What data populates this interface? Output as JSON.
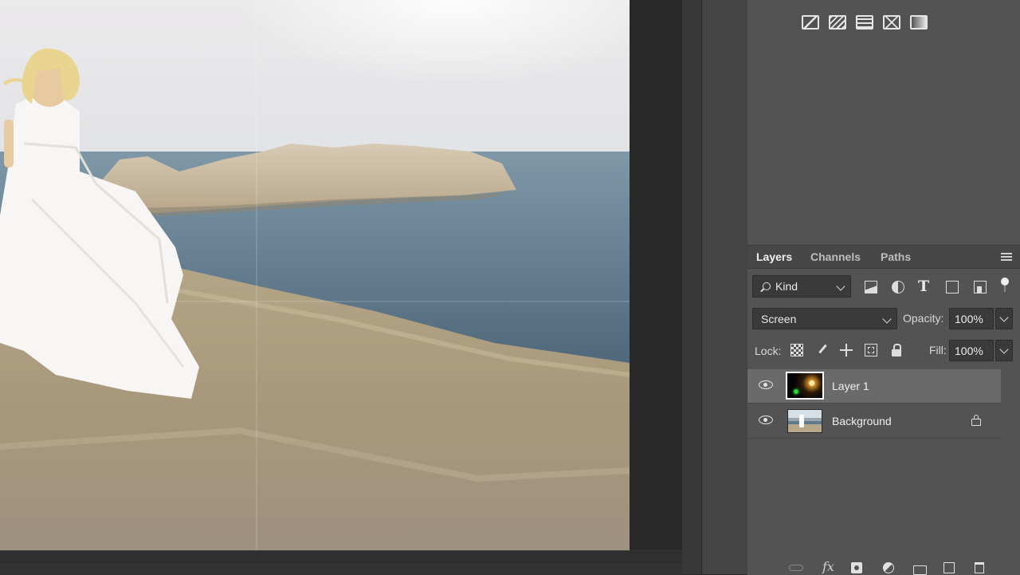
{
  "colors": {
    "panel_bg": "#535353",
    "selected_row": "#6a6a6a",
    "canvas_bg": "#282828"
  },
  "adjustments": {
    "icons": [
      "invert-icon",
      "posterize-icon",
      "threshold-icon",
      "selective-color-icon",
      "gradient-map-icon"
    ]
  },
  "layers_panel": {
    "tabs": [
      {
        "label": "Layers",
        "active": true
      },
      {
        "label": "Channels",
        "active": false
      },
      {
        "label": "Paths",
        "active": false
      }
    ],
    "filter": {
      "label": "Kind"
    },
    "blend_mode": "Screen",
    "opacity_label": "Opacity:",
    "opacity_value": "100%",
    "lock_label": "Lock:",
    "fill_label": "Fill:",
    "fill_value": "100%",
    "layers": [
      {
        "name": "Layer 1",
        "visible": true,
        "selected": true,
        "locked": false
      },
      {
        "name": "Background",
        "visible": true,
        "selected": false,
        "locked": true
      }
    ],
    "footer_icons": [
      "link-layers-icon",
      "fx-icon",
      "mask-icon",
      "new-adjustment-icon",
      "new-group-icon",
      "new-layer-icon",
      "delete-icon"
    ],
    "fx_label": "fx"
  }
}
